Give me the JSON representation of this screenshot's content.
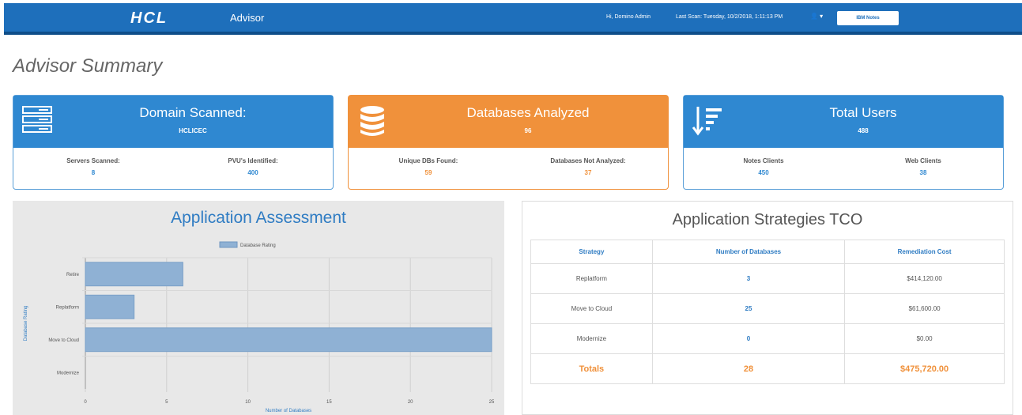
{
  "header": {
    "logo": "HCL",
    "app_name": "Advisor",
    "greeting": "Hi, Domino Admin",
    "last_scan": "Last Scan: Tuesday, 10/2/2018, 1:11:13 PM",
    "user_menu": "👤 ▾",
    "ibm_notes_label": "IBM Notes"
  },
  "page": {
    "title": "Advisor Summary"
  },
  "cards": {
    "domain": {
      "title": "Domain Scanned:",
      "value": "HCLICEC",
      "icon": "server-icon",
      "stats": [
        {
          "label": "Servers Scanned:",
          "value": "8"
        },
        {
          "label": "PVU's Identified:",
          "value": "400"
        }
      ]
    },
    "databases": {
      "title": "Databases Analyzed",
      "value": "96",
      "icon": "database-icon",
      "stats": [
        {
          "label": "Unique DBs Found:",
          "value": "59"
        },
        {
          "label": "Databases Not Analyzed:",
          "value": "37"
        }
      ]
    },
    "users": {
      "title": "Total Users",
      "value": "488",
      "icon": "sort-descending-icon",
      "stats": [
        {
          "label": "Notes Clients",
          "value": "450"
        },
        {
          "label": "Web Clients",
          "value": "38"
        }
      ]
    }
  },
  "assessment": {
    "title": "Application Assessment"
  },
  "chart_data": {
    "type": "bar",
    "orientation": "horizontal",
    "categories": [
      "Retire",
      "Replatform",
      "Move to Cloud",
      "Modernize"
    ],
    "series": [
      {
        "name": "Database Rating",
        "values": [
          6,
          3,
          25,
          0
        ],
        "color": "#8fb1d4"
      }
    ],
    "xlabel": "Number of Databases",
    "ylabel": "Database Rating",
    "xlim": [
      0,
      25
    ],
    "xticks": [
      0,
      5,
      10,
      15,
      20,
      25
    ],
    "legend_position": "top-center",
    "grid": true
  },
  "tco": {
    "title": "Application Strategies TCO",
    "headers": [
      "Strategy",
      "Number of Databases",
      "Remediation Cost"
    ],
    "rows": [
      [
        "Replatform",
        "3",
        "$414,120.00"
      ],
      [
        "Move to Cloud",
        "25",
        "$61,600.00"
      ],
      [
        "Modernize",
        "0",
        "$0.00"
      ]
    ],
    "totals": [
      "Totals",
      "28",
      "$475,720.00"
    ]
  },
  "colors": {
    "brand_blue": "#1e6fbb",
    "card_blue": "#2f88d1",
    "card_orange": "#f0913b",
    "bar": "#8fb1d4"
  }
}
